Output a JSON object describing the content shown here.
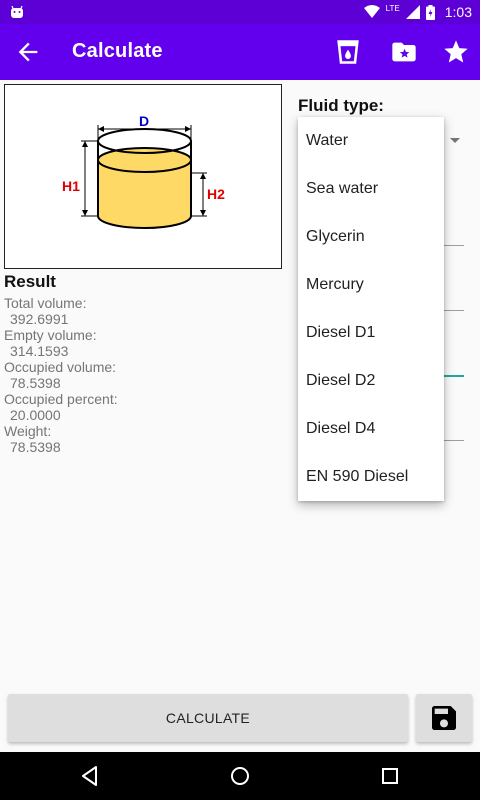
{
  "status_bar": {
    "time": "1:03",
    "network_label": "LTE",
    "icons": [
      "android-icon",
      "wifi-icon",
      "lte-signal-icon",
      "battery-icon"
    ]
  },
  "app_bar": {
    "title": "Calculate",
    "icons": [
      "back-arrow-icon",
      "cup-icon",
      "folder-star-icon",
      "star-icon"
    ]
  },
  "diagram": {
    "label_d": "D",
    "label_h1": "H1",
    "label_h2": "H2",
    "colors": {
      "liquid": "#ffd966",
      "d_label": "#0000cc",
      "h_label": "#e00000"
    }
  },
  "result": {
    "heading": "Result",
    "items": [
      {
        "label": "Total volume:",
        "value": "392.6991"
      },
      {
        "label": "Empty volume:",
        "value": "314.1593"
      },
      {
        "label": "Occupied volume:",
        "value": "78.5398"
      },
      {
        "label": "Occupied percent:",
        "value": "20.0000"
      },
      {
        "label": "Weight:",
        "value": "78.5398"
      }
    ]
  },
  "fluid": {
    "label": "Fluid type:",
    "options": [
      "Water",
      "Sea water",
      "Glycerin",
      "Mercury",
      "Diesel D1",
      "Diesel D2",
      "Diesel D4",
      "EN 590 Diesel"
    ]
  },
  "actions": {
    "calculate_label": "CALCULATE",
    "save_icon": "save-icon"
  },
  "nav_bar": {
    "icons": [
      "back-triangle-icon",
      "home-circle-icon",
      "recents-square-icon"
    ]
  },
  "theme": {
    "primary": "#6200ee",
    "primary_dark": "#5d00d6",
    "accent": "#26a69a"
  }
}
